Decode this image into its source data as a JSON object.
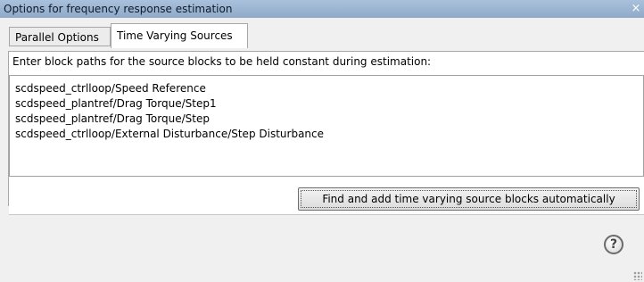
{
  "window": {
    "title": "Options for frequency response estimation",
    "close_glyph": "×"
  },
  "tabs": [
    {
      "label": "Parallel Options",
      "selected": false
    },
    {
      "label": "Time Varying Sources",
      "selected": true
    }
  ],
  "panel": {
    "instructions": "Enter block paths for the source blocks to be held constant during estimation:",
    "paths": [
      "scdspeed_ctrlloop/Speed Reference",
      "scdspeed_plantref/Drag Torque/Step1",
      "scdspeed_plantref/Drag Torque/Step",
      "scdspeed_ctrlloop/External Disturbance/Step Disturbance"
    ],
    "find_button_label": "Find and add time varying source blocks automatically"
  },
  "footer": {
    "help_glyph": "?",
    "help_icon": "help-icon",
    "grip_icon": "resize-grip-icon"
  }
}
